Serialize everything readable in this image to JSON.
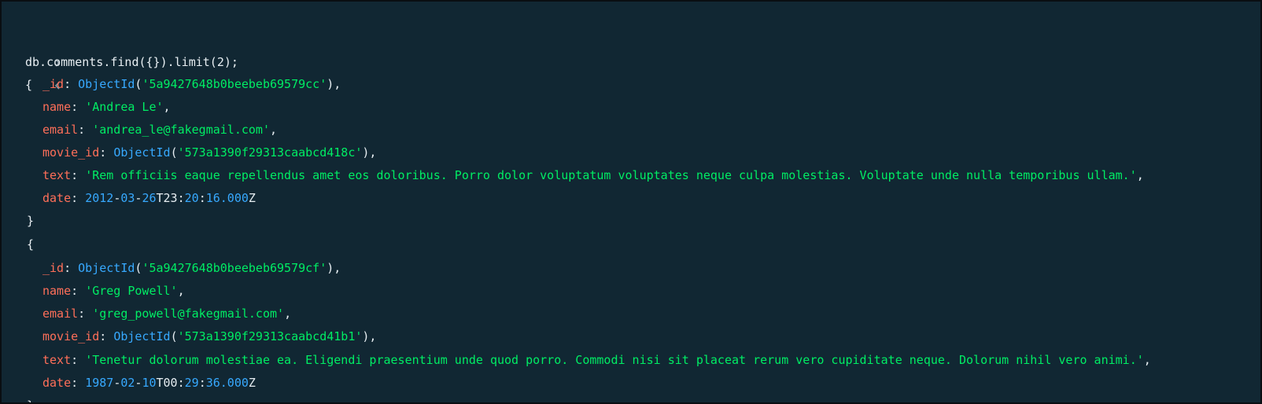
{
  "shell": {
    "prompt_icon": "chevron-right-icon",
    "result_icon": "chevron-left-icon",
    "command": "db.comments.find({}).limit(2);",
    "open_brace": "{",
    "close_brace": "}",
    "colors": {
      "background": "#112733",
      "key": "#ff6f59",
      "string": "#00ed64",
      "function": "#37a9ff",
      "number": "#37a9ff",
      "text": "#e7eef2"
    }
  },
  "documents": [
    {
      "id_key": "_id",
      "id_fn": "ObjectId",
      "id_value": "'5a9427648b0beebeb69579cc'",
      "name_key": "name",
      "name_value": "'Andrea Le'",
      "email_key": "email",
      "email_value": "'andrea_le@fakegmail.com'",
      "movie_id_key": "movie_id",
      "movie_id_fn": "ObjectId",
      "movie_id_value": "'573a1390f29313caabcd418c'",
      "text_key": "text",
      "text_value": "'Rem officiis eaque repellendus amet eos doloribus. Porro dolor voluptatum voluptates neque culpa molestias. Voluptate unde nulla temporibus ullam.'",
      "date_key": "date",
      "date_year": "2012",
      "date_month": "03",
      "date_day": "26",
      "date_hour": "T23",
      "date_min": "20",
      "date_sec": "16.000",
      "date_z": "Z"
    },
    {
      "id_key": "_id",
      "id_fn": "ObjectId",
      "id_value": "'5a9427648b0beebeb69579cf'",
      "name_key": "name",
      "name_value": "'Greg Powell'",
      "email_key": "email",
      "email_value": "'greg_powell@fakegmail.com'",
      "movie_id_key": "movie_id",
      "movie_id_fn": "ObjectId",
      "movie_id_value": "'573a1390f29313caabcd41b1'",
      "text_key": "text",
      "text_value": "'Tenetur dolorum molestiae ea. Eligendi praesentium unde quod porro. Commodi nisi sit placeat rerum vero cupiditate neque. Dolorum nihil vero animi.'",
      "date_key": "date",
      "date_year": "1987",
      "date_month": "02",
      "date_day": "10",
      "date_hour": "T00",
      "date_min": "29",
      "date_sec": "36.000",
      "date_z": "Z"
    }
  ]
}
